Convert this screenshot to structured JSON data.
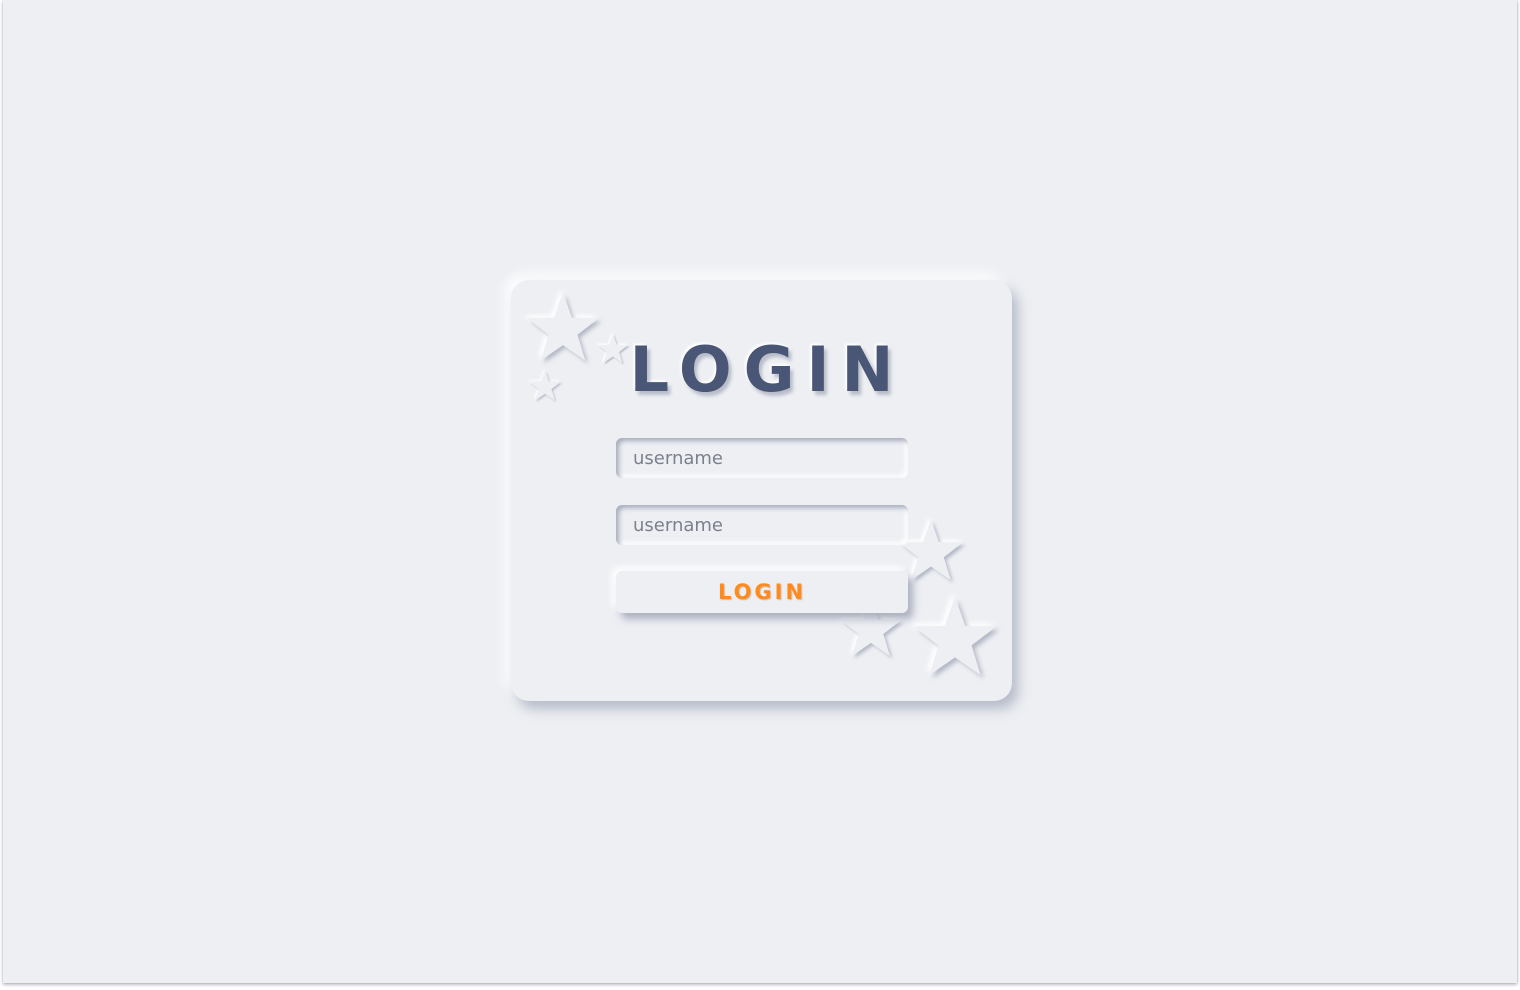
{
  "login_card": {
    "title": "LOGIN",
    "username_placeholder": "username",
    "password_placeholder": "username",
    "submit_label": "LOGIN"
  },
  "colors": {
    "background": "#edeff3",
    "title": "#4a5675",
    "button_text": "#ff8a1e"
  },
  "icons": [
    "star-icon"
  ]
}
